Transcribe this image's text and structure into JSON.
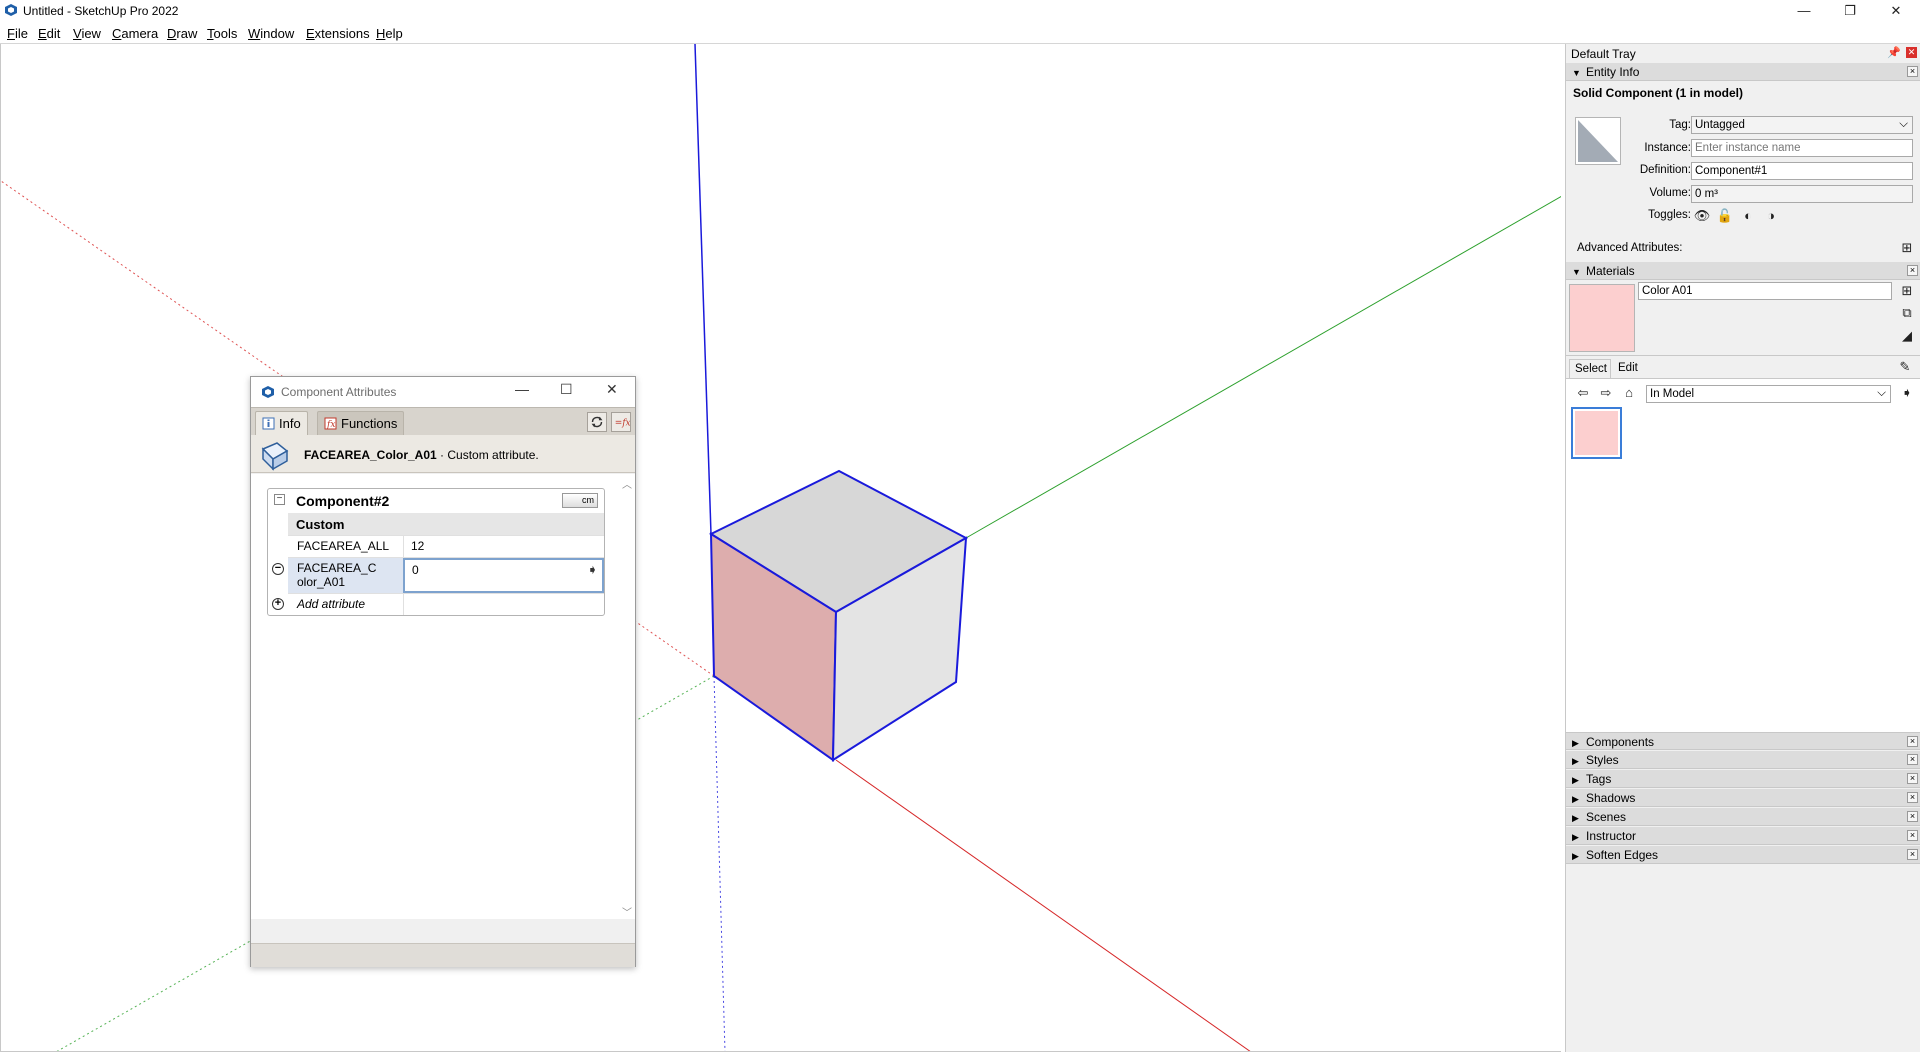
{
  "window": {
    "title": "Untitled - SketchUp Pro 2022",
    "controls": {
      "minimize": "—",
      "restore": "❐",
      "close": "✕"
    }
  },
  "menu": [
    "File",
    "Edit",
    "View",
    "Camera",
    "Draw",
    "Tools",
    "Window",
    "Extensions",
    "Help"
  ],
  "colors": {
    "axis_blue": "#1a1adb",
    "axis_green": "#2ca02c",
    "axis_red": "#d62728",
    "face_pink": "#ddadad",
    "face_grey_top": "#d7d7d7",
    "face_grey_right": "#e4e4e4",
    "material_swatch": "#fccfcf"
  },
  "component_attributes": {
    "title": "Component Attributes",
    "tabs": {
      "info": "Info",
      "functions": "Functions"
    },
    "info_bar": {
      "name": "FACEAREA_Color_A01",
      "description": " · Custom attribute."
    },
    "component_name": "Component#2",
    "units": "cm",
    "section": "Custom",
    "rows": [
      {
        "name": "FACEAREA_ALL",
        "value": "12"
      },
      {
        "name": "FACEAREA_C olor_A01",
        "value": "0"
      }
    ],
    "add_attribute": "Add attribute"
  },
  "tray": {
    "title": "Default Tray",
    "entity_info": {
      "panel_title": "Entity Info",
      "entity_title": "Solid Component (1 in model)",
      "labels": {
        "tag": "Tag:",
        "instance": "Instance:",
        "definition": "Definition:",
        "volume": "Volume:",
        "toggles": "Toggles:"
      },
      "tag_value": "Untagged",
      "instance_placeholder": "Enter instance name",
      "definition_value": "Component#1",
      "volume_value": "0 m³",
      "advanced_attributes": "Advanced Attributes:"
    },
    "materials": {
      "panel_title": "Materials",
      "material_name": "Color A01",
      "tabs": {
        "select": "Select",
        "edit": "Edit"
      },
      "library": "In Model"
    },
    "collapsed_panels": [
      "Components",
      "Styles",
      "Tags",
      "Shadows",
      "Scenes",
      "Instructor",
      "Soften Edges"
    ]
  }
}
